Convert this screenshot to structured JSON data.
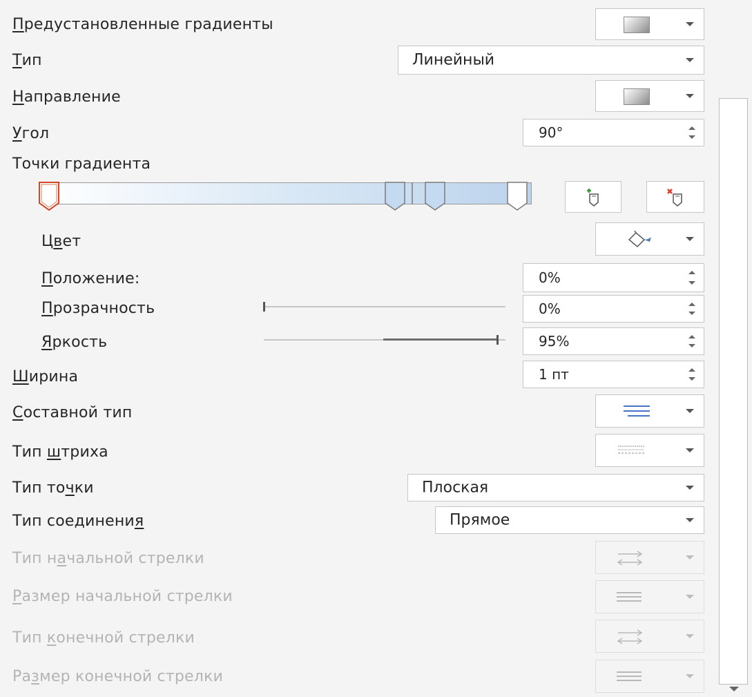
{
  "rows": {
    "preset": {
      "label_u": "П",
      "label_rest": "редустановленные градиенты"
    },
    "type": {
      "label_u": "Т",
      "label_rest": "ип",
      "value": "Линейный"
    },
    "direction": {
      "label_u": "Н",
      "label_rest": "аправление"
    },
    "angle": {
      "label_u": "У",
      "label_rest": "гол",
      "value": "90°"
    },
    "gradient_stops": {
      "label": "Точки градиента"
    },
    "color": {
      "label_pre": "Ц",
      "label_u": "в",
      "label_rest": "ет"
    },
    "position": {
      "label_u": "П",
      "label_rest": "оложение:",
      "value": "0%"
    },
    "transparency": {
      "label_u": "П",
      "label_rest": "розрачность",
      "value": "0%",
      "level": 0.0
    },
    "brightness": {
      "label_u": "Я",
      "label_rest": "ркость",
      "value": "95%",
      "level": 0.95
    },
    "width": {
      "label_u": "Ш",
      "label_rest": "ирина",
      "value": "1 пт"
    },
    "compound": {
      "label_u": "С",
      "label_rest": "оставной тип"
    },
    "dash": {
      "label_pre": "Тип ",
      "label_u": "ш",
      "label_rest": "триха"
    },
    "cap": {
      "label_pre": "Тип то",
      "label_u": "ч",
      "label_rest": "ки",
      "value": "Плоская"
    },
    "join": {
      "label_pre": "Тип соединени",
      "label_u": "я",
      "label_rest": "",
      "value": "Прямое"
    },
    "begin_arrow_type": {
      "label_pre": "Тип н",
      "label_u": "а",
      "label_rest": "чальной стрелки"
    },
    "begin_arrow_size": {
      "label_pre": "",
      "label_u": "Р",
      "label_rest": "азмер начальной стрелки"
    },
    "end_arrow_type": {
      "label_pre": "Тип ",
      "label_u": "к",
      "label_rest": "онечной стрелки"
    },
    "end_arrow_size": {
      "label_pre": "Ра",
      "label_u": "з",
      "label_rest": "мер конечной стрелки"
    }
  },
  "icons": {
    "preset": "gradient-swatch-icon",
    "direction": "gradient-swatch-icon",
    "add_stop": "add-gradient-stop-icon",
    "remove_stop": "remove-gradient-stop-icon",
    "color": "paint-bucket-icon",
    "compound": "compound-lines-icon",
    "dash": "dash-lines-icon",
    "begin_arrow_type": "arrow-type-icon",
    "begin_arrow_size": "arrow-size-icon",
    "end_arrow_type": "arrow-type-icon",
    "end_arrow_size": "arrow-size-icon"
  },
  "colors": {
    "accent": "#4472c4",
    "selected_stop_border": "#d24726",
    "remove_red": "#e03b24",
    "add_green": "#3d9a3d"
  }
}
